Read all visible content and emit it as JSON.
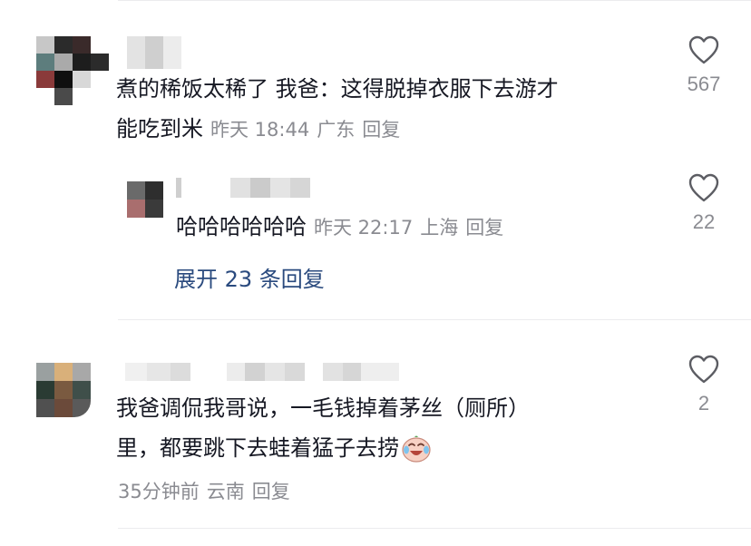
{
  "comments": [
    {
      "text_line1": "煮的稀饭太稀了 我爸：这得脱掉衣服下去游才",
      "text_line2": "能吃到米",
      "time": "昨天 18:44",
      "location": "广东",
      "reply_label": "回复",
      "likes": "567",
      "replies": [
        {
          "text": "哈哈哈哈哈哈",
          "time": "昨天 22:17",
          "location": "上海",
          "reply_label": "回复",
          "likes": "22"
        }
      ],
      "expand_label": "展开 23 条回复"
    },
    {
      "text_line1": "我爸调侃我哥说，一毛钱掉着茅丝（厕所）",
      "text_line2": "里，都要跳下去蛙着猛子去捞",
      "emoji": "laughing-crying-emoji",
      "time": "35分钟前",
      "location": "云南",
      "reply_label": "回复",
      "likes": "2"
    }
  ],
  "colors": {
    "text": "#161823",
    "meta": "#8a8b91",
    "link": "#2a4a7e",
    "divider": "#ececee"
  }
}
